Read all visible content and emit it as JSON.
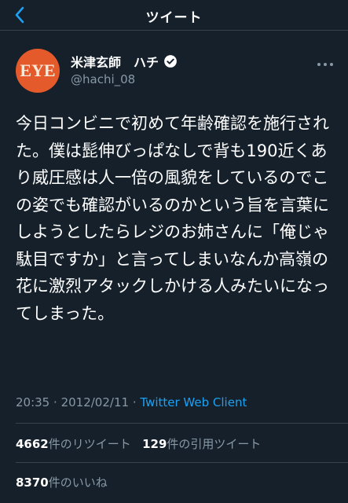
{
  "header": {
    "title": "ツイート",
    "back_icon": "chevron-left-icon"
  },
  "author": {
    "avatar_text": "EYE",
    "avatar_color": "#e55a2b",
    "display_name": "米津玄師　ハチ",
    "verified": true,
    "handle": "@hachi_08"
  },
  "tweet": {
    "text": "今日コンビニで初めて年齢確認を施行された。僕は髭伸びっぱなしで背も190近くあり威圧感は人一倍の風貌をしているのでこの姿でも確認がいるのかという旨を言葉にしようとしたらレジのお姉さんに「俺じゃ駄目ですか」と言ってしまいなんか高嶺の花に激烈アタックしかける人みたいになってしまった。",
    "time": "20:35",
    "date": "2012/02/11",
    "separator": "·",
    "client": "Twitter Web Client"
  },
  "stats": {
    "retweets_count": "4662",
    "retweets_label": "件のリツイート",
    "quotes_count": "129",
    "quotes_label": "件の引用ツイート",
    "likes_count": "8370",
    "likes_label": "件のいいね"
  },
  "colors": {
    "background": "#15202b",
    "accent": "#1da1f2",
    "secondary_text": "#8899a6",
    "divider": "#38444d"
  }
}
